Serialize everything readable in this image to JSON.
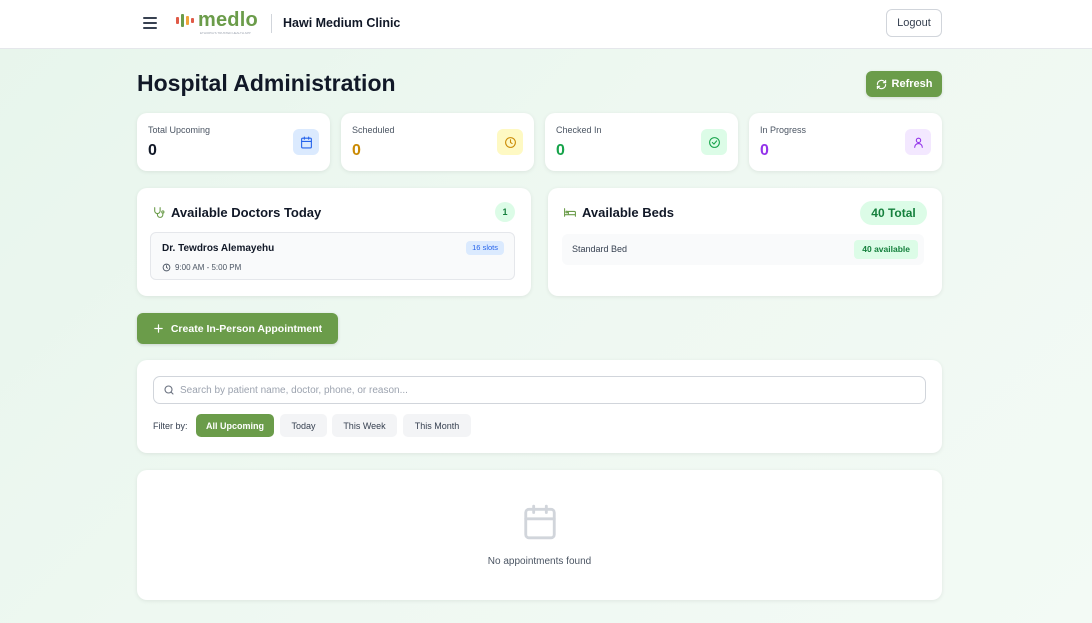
{
  "header": {
    "logo_text": "medlo",
    "logo_tagline": "ETHIOPIA'S TRUSTED HEALTH APP",
    "clinic_name": "Hawi Medium Clinic",
    "logout_label": "Logout"
  },
  "page": {
    "title": "Hospital Administration",
    "refresh_label": "Refresh"
  },
  "stats": [
    {
      "label": "Total Upcoming",
      "value": "0",
      "color": "#111827",
      "icon": "calendar-icon",
      "icon_bg": "#dbeafe",
      "icon_color": "#2563eb"
    },
    {
      "label": "Scheduled",
      "value": "0",
      "color": "#ca8a04",
      "icon": "clock-icon",
      "icon_bg": "#fef9c3",
      "icon_color": "#ca8a04"
    },
    {
      "label": "Checked In",
      "value": "0",
      "color": "#16a34a",
      "icon": "check-circle-icon",
      "icon_bg": "#dcfce7",
      "icon_color": "#16a34a"
    },
    {
      "label": "In Progress",
      "value": "0",
      "color": "#9333ea",
      "icon": "user-icon",
      "icon_bg": "#f3e8ff",
      "icon_color": "#9333ea"
    }
  ],
  "doctors": {
    "title": "Available Doctors Today",
    "count": "1",
    "items": [
      {
        "name": "Dr. Tewdros Alemayehu",
        "slots": "16 slots",
        "time": "9:00 AM - 5:00 PM"
      }
    ]
  },
  "beds": {
    "title": "Available Beds",
    "total": "40 Total",
    "items": [
      {
        "name": "Standard Bed",
        "available": "40 available"
      }
    ]
  },
  "actions": {
    "create_label": "Create In-Person Appointment"
  },
  "search": {
    "placeholder": "Search by patient name, doctor, phone, or reason...",
    "value": ""
  },
  "filters": {
    "label": "Filter by:",
    "options": [
      "All Upcoming",
      "Today",
      "This Week",
      "This Month"
    ],
    "selected": "All Upcoming"
  },
  "appointments": {
    "empty_text": "No appointments found"
  },
  "colors": {
    "brand": "#6b9c4a",
    "background": "#eaf6ee"
  }
}
